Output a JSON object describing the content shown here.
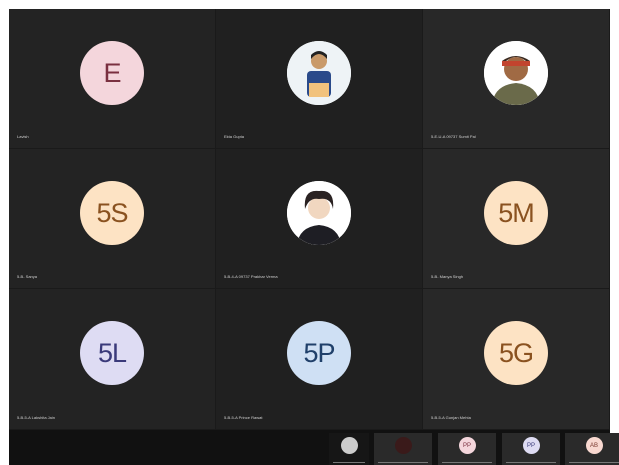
{
  "participants": [
    {
      "initials": "E",
      "bg": "#f4d6dc",
      "fg": "#7a3040",
      "name": "Lavish"
    },
    {
      "photo": "person-standing",
      "name": "Ekta Gupta"
    },
    {
      "photo": "person-cap",
      "name": "5-E-U-A 09737 Sumit Pal"
    },
    {
      "initials": "5S",
      "bg": "#fde3c4",
      "fg": "#8a5220",
      "name": "5-B- Sanya"
    },
    {
      "photo": "person-dark-jacket",
      "name": "5-B-4-A 09737 Prakhar Verma"
    },
    {
      "initials": "5M",
      "bg": "#fde3c4",
      "fg": "#8a5220",
      "name": "5-B- Manya Singh"
    },
    {
      "initials": "5L",
      "bg": "#dedcf3",
      "fg": "#3a3a7a",
      "name": "5-B-5-A Lakshita Jain"
    },
    {
      "initials": "5P",
      "bg": "#cfe0f4",
      "fg": "#20406a",
      "name": "5-B-5-A Prince Rawat"
    },
    {
      "initials": "5G",
      "bg": "#fde3c4",
      "fg": "#8a5220",
      "name": "5-B-5-A Gunjan Mehta"
    }
  ],
  "bottom_strip": [
    {
      "kind": "photo",
      "color": "#cccccc"
    },
    {
      "kind": "photo",
      "color": "#3a1a1a"
    },
    {
      "kind": "initials",
      "initials": "PP",
      "bg": "#f4d6dc",
      "fg": "#7a3040"
    },
    {
      "kind": "initials",
      "initials": "PP",
      "bg": "#dedcf3",
      "fg": "#3a3a7a"
    },
    {
      "kind": "initials",
      "initials": "AB",
      "bg": "#f8d8d0",
      "fg": "#7a3a30"
    }
  ]
}
